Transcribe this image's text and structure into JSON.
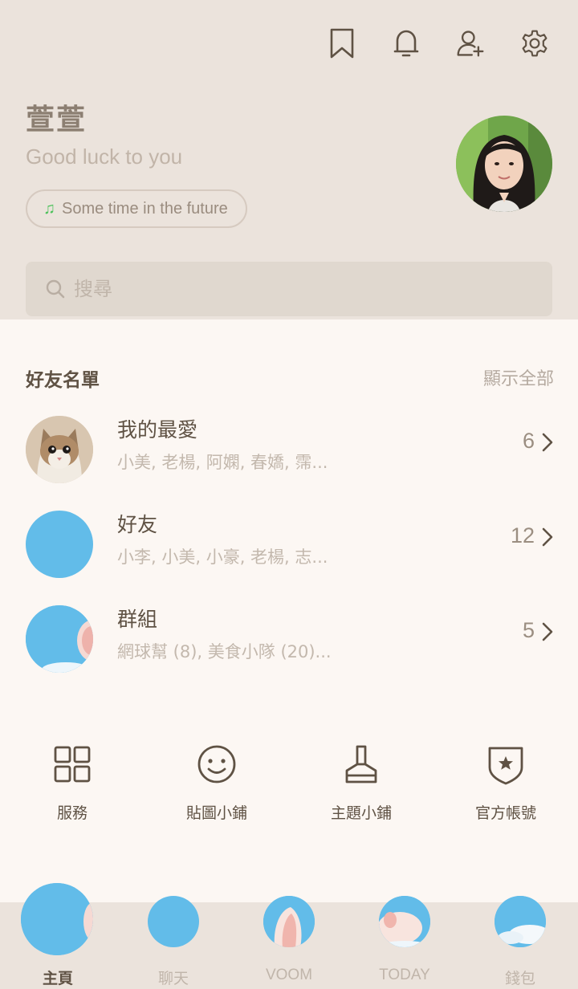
{
  "profile": {
    "name": "萱萱",
    "status_message": "Good luck to you",
    "music": "Some time in the future"
  },
  "top_icons": [
    "bookmark-icon",
    "bell-icon",
    "add-friend-icon",
    "gear-icon"
  ],
  "search": {
    "placeholder": "搜尋"
  },
  "friends_section": {
    "title": "好友名單",
    "show_all": "顯示全部",
    "rows": [
      {
        "title": "我的最愛",
        "subtitle": "小美, 老楊, 阿嫻, 春嬌, 霈...",
        "count": "6"
      },
      {
        "title": "好友",
        "subtitle": "小李, 小美, 小豪, 老楊, 志...",
        "count": "12"
      },
      {
        "title": "群組",
        "subtitle": "網球幫 (8), 美食小隊 (20)...",
        "count": "5"
      }
    ]
  },
  "services": [
    {
      "label": "服務",
      "icon": "grid-icon"
    },
    {
      "label": "貼圖小鋪",
      "icon": "smiley-icon"
    },
    {
      "label": "主題小鋪",
      "icon": "brush-icon"
    },
    {
      "label": "官方帳號",
      "icon": "shield-star-icon"
    }
  ],
  "bottom_nav": [
    {
      "label": "主頁",
      "active": true
    },
    {
      "label": "聊天"
    },
    {
      "label": "VOOM"
    },
    {
      "label": "TODAY"
    },
    {
      "label": "錢包"
    }
  ],
  "colors": {
    "header_bg": "#ebe3dc",
    "body_bg": "#fcf7f3",
    "accent_blue": "#62bce9",
    "text_main": "#5f5244",
    "text_muted": "#c3b8ad",
    "music_note": "#4cc15a"
  }
}
